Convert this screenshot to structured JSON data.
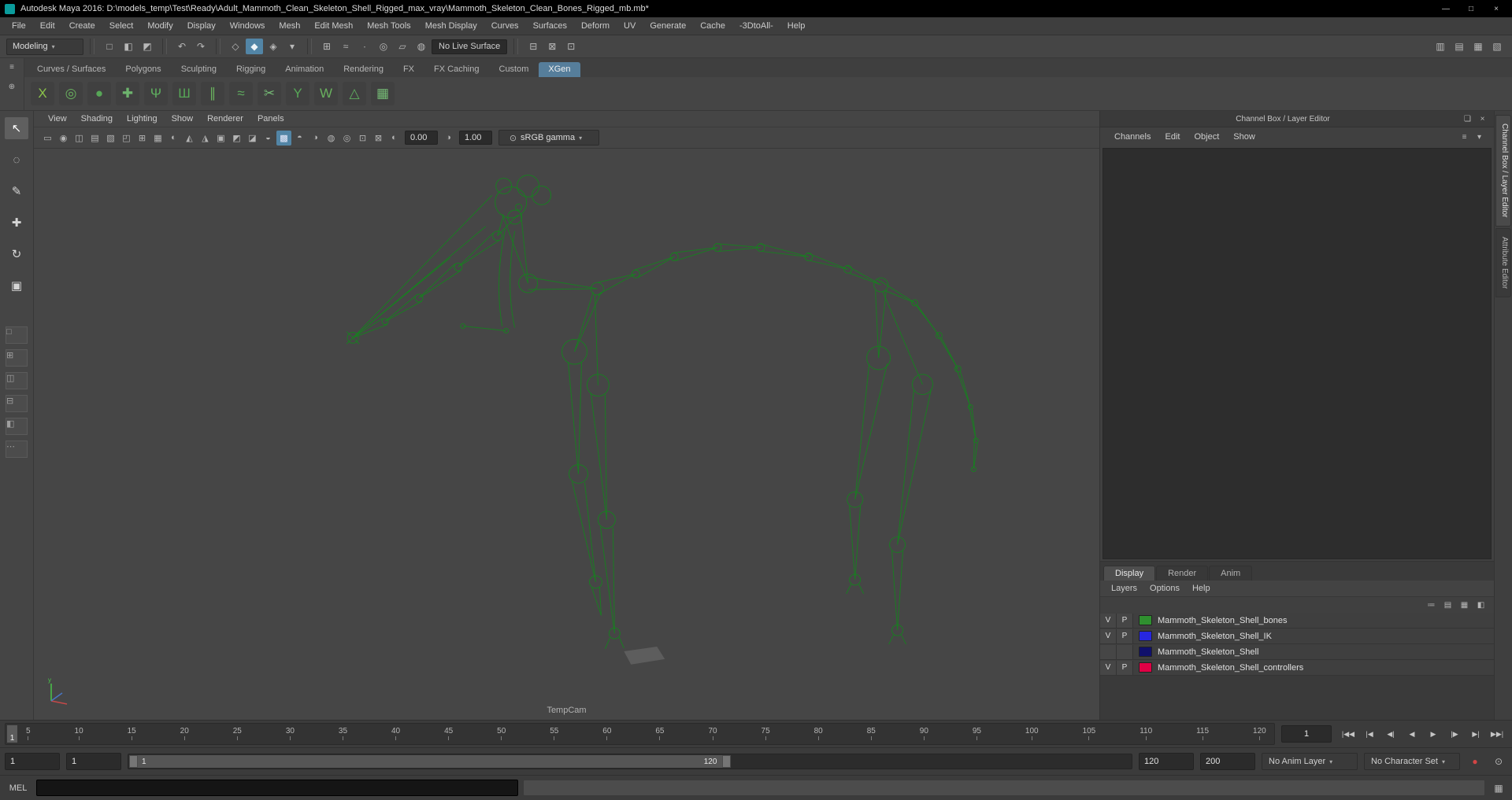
{
  "window": {
    "title": "Autodesk Maya 2016: D:\\models_temp\\Test\\Ready\\Adult_Mammoth_Clean_Skeleton_Shell_Rigged_max_vray\\Mammoth_Skeleton_Clean_Bones_Rigged_mb.mb*",
    "controls": {
      "minimize": "—",
      "maximize": "□",
      "close": "×"
    }
  },
  "menu_bar": [
    "File",
    "Edit",
    "Create",
    "Select",
    "Modify",
    "Display",
    "Windows",
    "Mesh",
    "Edit Mesh",
    "Mesh Tools",
    "Mesh Display",
    "Curves",
    "Surfaces",
    "Deform",
    "UV",
    "Generate",
    "Cache",
    "-3DtoAll-",
    "Help"
  ],
  "status_line": {
    "menu_set": "Modeling",
    "file_buttons": [
      {
        "name": "new-scene-icon",
        "glyph": "□"
      },
      {
        "name": "open-scene-icon",
        "glyph": "◧"
      },
      {
        "name": "save-scene-icon",
        "glyph": "◩"
      }
    ],
    "undo_buttons": [
      {
        "name": "undo-icon",
        "glyph": "↶"
      },
      {
        "name": "redo-icon",
        "glyph": "↷"
      }
    ],
    "selection_buttons": [
      {
        "name": "select-hierarchy-icon",
        "glyph": "◇"
      },
      {
        "name": "select-object-icon",
        "glyph": "◆",
        "active": true
      },
      {
        "name": "select-component-icon",
        "glyph": "◈"
      },
      {
        "name": "selection-mask-icon",
        "glyph": "▾"
      }
    ],
    "snap_buttons": [
      {
        "name": "snap-grid-icon",
        "glyph": "⊞"
      },
      {
        "name": "snap-curve-icon",
        "glyph": "≈"
      },
      {
        "name": "snap-point-icon",
        "glyph": "∙"
      },
      {
        "name": "snap-projected-center-icon",
        "glyph": "◎"
      },
      {
        "name": "snap-view-plane-icon",
        "glyph": "▱"
      },
      {
        "name": "make-live-icon",
        "glyph": "◍"
      }
    ],
    "live_surface": "No Live Surface",
    "history_buttons": [
      {
        "name": "input-operations-icon",
        "glyph": "⊟"
      },
      {
        "name": "output-operations-icon",
        "glyph": "⊠"
      },
      {
        "name": "construction-history-icon",
        "glyph": "⊡"
      }
    ],
    "right_buttons": [
      {
        "name": "attribute-editor-toggle-icon",
        "glyph": "▥"
      },
      {
        "name": "tool-settings-toggle-icon",
        "glyph": "▤"
      },
      {
        "name": "channel-box-toggle-icon",
        "glyph": "▦"
      },
      {
        "name": "modeling-toolkit-toggle-icon",
        "glyph": "▧"
      }
    ]
  },
  "shelf": {
    "rail_icons": [
      {
        "name": "shelf-tabs-toggle-icon",
        "glyph": "≡"
      },
      {
        "name": "shelf-editor-icon",
        "glyph": "⊕"
      }
    ],
    "tabs": [
      {
        "label": "Curves / Surfaces"
      },
      {
        "label": "Polygons"
      },
      {
        "label": "Sculpting"
      },
      {
        "label": "Rigging"
      },
      {
        "label": "Animation"
      },
      {
        "label": "Rendering"
      },
      {
        "label": "FX"
      },
      {
        "label": "FX Caching"
      },
      {
        "label": "Custom"
      },
      {
        "label": "XGen",
        "active": true
      }
    ],
    "icons": [
      {
        "name": "xgen-shelf-icon",
        "glyph": "X",
        "color": "#8bc34a"
      },
      {
        "name": "xgen-shelf-icon",
        "glyph": "◎",
        "color": "#69b05e"
      },
      {
        "name": "xgen-shelf-icon",
        "glyph": "●",
        "color": "#57a657"
      },
      {
        "name": "xgen-shelf-icon",
        "glyph": "✚",
        "color": "#6db36d"
      },
      {
        "name": "xgen-shelf-icon",
        "glyph": "Ψ",
        "color": "#5fae5f"
      },
      {
        "name": "xgen-shelf-icon",
        "glyph": "Ш",
        "color": "#57a657"
      },
      {
        "name": "xgen-shelf-icon",
        "glyph": "∥",
        "color": "#69b05e"
      },
      {
        "name": "xgen-shelf-icon",
        "glyph": "≈",
        "color": "#5fae5f"
      },
      {
        "name": "xgen-shelf-icon",
        "glyph": "✂",
        "color": "#74b874"
      },
      {
        "name": "xgen-shelf-icon",
        "glyph": "Y",
        "color": "#57a657"
      },
      {
        "name": "xgen-shelf-icon",
        "glyph": "W",
        "color": "#69b05e"
      },
      {
        "name": "xgen-shelf-icon",
        "glyph": "△",
        "color": "#5fae5f"
      },
      {
        "name": "xgen-shelf-icon",
        "glyph": "▦",
        "color": "#74b874"
      }
    ]
  },
  "toolbox": {
    "tools": [
      {
        "name": "select-tool-icon",
        "glyph": "↖",
        "active": true
      },
      {
        "name": "lasso-tool-icon",
        "glyph": "◌"
      },
      {
        "name": "paint-select-tool-icon",
        "glyph": "✎"
      },
      {
        "name": "move-tool-icon",
        "glyph": "✚"
      },
      {
        "name": "rotate-tool-icon",
        "glyph": "↻"
      },
      {
        "name": "scale-tool-icon",
        "glyph": "▣"
      }
    ],
    "layouts": [
      {
        "name": "single-pane-layout-icon",
        "glyph": "□"
      },
      {
        "name": "four-pane-layout-icon",
        "glyph": "⊞"
      },
      {
        "name": "two-pane-side-layout-icon",
        "glyph": "◫"
      },
      {
        "name": "two-pane-stacked-layout-icon",
        "glyph": "⊟"
      },
      {
        "name": "three-pane-layout-icon",
        "glyph": "◧"
      },
      {
        "name": "more-layouts-icon",
        "glyph": "⋯"
      }
    ]
  },
  "viewport": {
    "menus": [
      "View",
      "Shading",
      "Lighting",
      "Show",
      "Renderer",
      "Panels"
    ],
    "toolbar_icons": [
      {
        "name": "select-camera-icon",
        "glyph": "▭"
      },
      {
        "name": "lock-camera-icon",
        "glyph": "◉"
      },
      {
        "name": "camera-attributes-icon",
        "glyph": "◫"
      },
      {
        "name": "bookmarks-icon",
        "glyph": "▤"
      },
      {
        "name": "image-plane-icon",
        "glyph": "▧"
      },
      {
        "name": "pan-zoom-icon",
        "glyph": "◰"
      },
      {
        "name": "grid-icon",
        "glyph": "⊞"
      },
      {
        "name": "film-gate-icon",
        "glyph": "▦"
      },
      {
        "name": "resolution-gate-icon",
        "glyph": "◐"
      },
      {
        "name": "gate-mask-icon",
        "glyph": "◭"
      },
      {
        "name": "field-chart-icon",
        "glyph": "◮"
      },
      {
        "name": "safe-action-icon",
        "glyph": "▣"
      },
      {
        "name": "safe-title-icon",
        "glyph": "◩"
      },
      {
        "name": "wireframe-icon",
        "glyph": "◪"
      },
      {
        "name": "shaded-icon",
        "glyph": "◒"
      },
      {
        "name": "textured-icon",
        "glyph": "▩",
        "active": true
      },
      {
        "name": "lights-icon",
        "glyph": "◓"
      },
      {
        "name": "shadows-icon",
        "glyph": "◑"
      },
      {
        "name": "occlusion-icon",
        "glyph": "◍"
      },
      {
        "name": "motion-blur-icon",
        "glyph": "◎"
      },
      {
        "name": "xray-icon",
        "glyph": "⊡"
      },
      {
        "name": "isolate-select-icon",
        "glyph": "⊠"
      }
    ],
    "exposure_icon": "◐",
    "exposure": "0.00",
    "gamma_icon": "◑",
    "gamma": "1.00",
    "cm_icon": "⊙",
    "color_transform": "sRGB gamma",
    "camera_label": "TempCam"
  },
  "channel_box": {
    "dock_title": "Channel Box / Layer Editor",
    "header_icons": [
      {
        "name": "float-panel-icon",
        "glyph": "❏"
      },
      {
        "name": "close-panel-icon",
        "glyph": "×"
      }
    ],
    "menus": [
      "Channels",
      "Edit",
      "Object",
      "Show"
    ],
    "menu_icons": [
      {
        "name": "channel-manipulator-icon",
        "glyph": "≡"
      },
      {
        "name": "channel-speed-icon",
        "glyph": "▾"
      }
    ]
  },
  "layer_editor": {
    "tabs": [
      {
        "label": "Display",
        "active": true
      },
      {
        "label": "Render"
      },
      {
        "label": "Anim"
      }
    ],
    "menus": [
      "Layers",
      "Options",
      "Help"
    ],
    "toolbar_icons": [
      {
        "name": "sort-layers-icon",
        "glyph": "≔"
      },
      {
        "name": "new-empty-layer-icon",
        "glyph": "▤"
      },
      {
        "name": "new-layer-from-selected-icon",
        "glyph": "▦"
      },
      {
        "name": "layer-attributes-icon",
        "glyph": "◧"
      }
    ],
    "layers": [
      {
        "visible": "V",
        "playback": "P",
        "color": "#2f8f2f",
        "name": "Mammoth_Skeleton_Shell_bones"
      },
      {
        "visible": "V",
        "playback": "P",
        "color": "#2727e0",
        "name": "Mammoth_Skeleton_Shell_IK"
      },
      {
        "visible": "",
        "playback": "",
        "color": "#10106b",
        "name": "Mammoth_Skeleton_Shell"
      },
      {
        "visible": "V",
        "playback": "P",
        "color": "#e00045",
        "name": "Mammoth_Skeleton_Shell_controllers"
      }
    ]
  },
  "side_dock_tabs": [
    {
      "label": "Channel Box / Layer Editor",
      "active": true
    },
    {
      "label": "Attribute Editor"
    }
  ],
  "timeline": {
    "ticks": [
      "5",
      "10",
      "15",
      "20",
      "25",
      "30",
      "35",
      "40",
      "45",
      "50",
      "55",
      "60",
      "65",
      "70",
      "75",
      "80",
      "85",
      "90",
      "95",
      "100",
      "105",
      "110",
      "115",
      "120"
    ],
    "current_frame": "1",
    "frame_field": "1",
    "playback": [
      {
        "name": "go-to-start-button",
        "glyph": "|◀◀"
      },
      {
        "name": "step-back-key-button",
        "glyph": "|◀"
      },
      {
        "name": "step-back-frame-button",
        "glyph": "◀|"
      },
      {
        "name": "play-backwards-button",
        "glyph": "◀"
      },
      {
        "name": "play-forwards-button",
        "glyph": "▶"
      },
      {
        "name": "step-forward-frame-button",
        "glyph": "|▶"
      },
      {
        "name": "step-forward-key-button",
        "glyph": "▶|"
      },
      {
        "name": "go-to-end-button",
        "glyph": "▶▶|"
      }
    ]
  },
  "range_slider": {
    "anim_start": "1",
    "playback_start": "1",
    "range_start": "1",
    "range_end": "120",
    "playback_end": "120",
    "anim_end": "200",
    "anim_layer": "No Anim Layer",
    "character_set": "No Character Set",
    "autokey_glyph": "●",
    "prefs_glyph": "⊙"
  },
  "command_line": {
    "label": "MEL",
    "input_value": "",
    "script_editor_glyph": "▦"
  }
}
